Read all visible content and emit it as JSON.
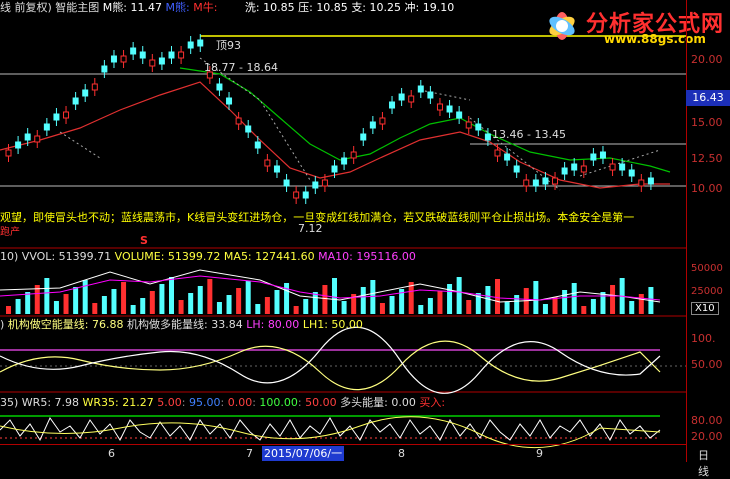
{
  "main_header": {
    "title": "线 前复权) 智能主图",
    "m_bear_label": "M熊: ",
    "m_bear_val": "11.47",
    "m_bear2_label": "M熊: ",
    "m_bull_label": "M牛: ",
    "wash_label": "洗: ",
    "wash_val": "10.85",
    "press_label": "压: ",
    "press_val": "10.85",
    "support_label": "支: ",
    "support_val": "10.25",
    "rush_label": "冲: ",
    "rush_val": "19.10"
  },
  "logo": {
    "title": "分析家公式网",
    "url": "www.88gs.com"
  },
  "annotations": {
    "top": "顶93",
    "range_high": "18.77 - 18.64",
    "range_mid": "13.46 - 13.45",
    "low_price": "7.12",
    "warning_text": "观望，即使冒头也不动；蓝线震荡市，K线冒头变红进场仓，一旦变成红线加满仓，若又跌破蓝线则平仓止损出场。本金安全是第一",
    "left_tag": "跑产",
    "s_marker": "S",
    "b_marker": "B"
  },
  "price_axis": {
    "ticks": [
      "20.00",
      "17.50",
      "15.00",
      "12.50",
      "10.00"
    ],
    "current_price": "16.43"
  },
  "volume_panel": {
    "header_prefix": "10)",
    "vvol_label": "VVOL: ",
    "vvol_val": "51399.71",
    "volume_label": "VOLUME: ",
    "volume_val": "51399.72",
    "ma5_label": "MA5: ",
    "ma5_val": "127441.60",
    "ma10_label": "MA10: ",
    "ma10_val": "195116.00",
    "ticks": [
      "50000",
      "25000"
    ],
    "unit": "X10"
  },
  "energy_panel": {
    "header_prefix": ")",
    "empty_label": "机构做空能量线: ",
    "empty_val": "76.88",
    "long_label": "机构做多能量线: ",
    "long_val": "33.84",
    "lh_label": "LH: ",
    "lh_val": "80.00",
    "lh1_label": "LH1: ",
    "lh1_val": "50.00",
    "ticks": [
      "100.",
      "50.00"
    ]
  },
  "wr_panel": {
    "header_prefix": "35)",
    "wr5_label": "WR5: ",
    "wr5_val": "7.98",
    "wr35_label": "WR35: ",
    "wr35_val": "21.27",
    "v1": "5.00",
    "v2": "95.00",
    "v3": "0.00",
    "v4": "100.00",
    "v5": "50.00",
    "bull_label": "多头能量: ",
    "bull_val": "0.00",
    "buy_label": "买入: ",
    "ticks": [
      "80.00",
      "20.00"
    ]
  },
  "date_axis": {
    "labels": [
      "6",
      "7",
      "8",
      "9"
    ],
    "selected": "2015/07/06/一",
    "period": "日线"
  },
  "colors": {
    "up": "#ff3030",
    "down": "#54ffff",
    "accent_yellow": "#ffff00",
    "magenta": "#ff00ff",
    "green": "#00c000"
  }
}
